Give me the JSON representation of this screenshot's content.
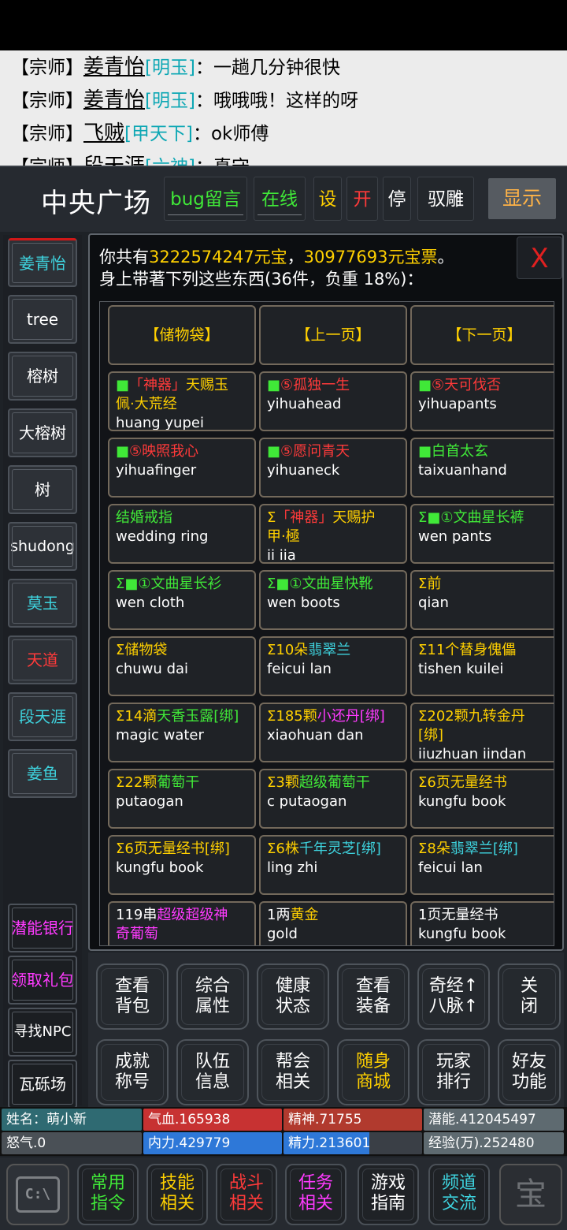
{
  "chat": [
    {
      "prefix": "【宗师】",
      "name": "姜青怡",
      "tag": "[明玉]",
      "msg": "：一趟几分钟很快"
    },
    {
      "prefix": "【宗师】",
      "name": "姜青怡",
      "tag": "[明玉]",
      "msg": "：哦哦哦！这样的呀"
    },
    {
      "prefix": "【宗师】",
      "name": "飞贼",
      "tag": "[甲天下]",
      "msg": "：ok师傅"
    },
    {
      "prefix": "【宗师】",
      "name": "段天涯",
      "tag": "[六神]",
      "msg": "：真守"
    }
  ],
  "header": {
    "location": "中央广场",
    "buttons": [
      "bug留言",
      "在线",
      "设",
      "开",
      "停",
      "驭雕"
    ],
    "show_label": "显示"
  },
  "left_players": [
    "姜青怡",
    "tree",
    "榕树",
    "大榕树",
    "树",
    "shudong",
    "莫玉",
    "天道",
    "段天涯",
    "姜鱼"
  ],
  "left_funcs": [
    "潜能银行",
    "领取礼包",
    "寻找NPC",
    "瓦砾场"
  ],
  "panel": {
    "line1_a": "你共有",
    "gold": "3222574247元宝",
    "line1_b": "，",
    "tickets": "30977693元宝票",
    "line1_c": "。",
    "line2": "身上带著下列这些东西(36件，负重 18%)：",
    "close": "X"
  },
  "nav": [
    "【储物袋】",
    "【上一页】",
    "【下一页】"
  ],
  "items": [
    {
      "p1": "■",
      "p1c": "g",
      "p2": "「神器」",
      "p2c": "r",
      "p3": "天赐玉",
      "p3c": "y",
      "line1b": "佩·大荒经",
      "line1bc": "y",
      "sub": "huang yupei"
    },
    {
      "p1": "■",
      "p1c": "g",
      "p2": "⑤孤独一生",
      "p2c": "r",
      "p3": "",
      "p3c": "w",
      "line1b": "",
      "line1bc": "w",
      "sub": "yihuahead"
    },
    {
      "p1": "■",
      "p1c": "g",
      "p2": "⑤天可伐否",
      "p2c": "r",
      "p3": "",
      "p3c": "w",
      "line1b": "",
      "line1bc": "w",
      "sub": "yihuapants"
    },
    {
      "p1": "■",
      "p1c": "g",
      "p2": "⑤映照我心",
      "p2c": "r",
      "p3": "",
      "p3c": "w",
      "line1b": "",
      "line1bc": "w",
      "sub": "yihuafinger"
    },
    {
      "p1": "■",
      "p1c": "g",
      "p2": "⑤愿问青天",
      "p2c": "r",
      "p3": "",
      "p3c": "w",
      "line1b": "",
      "line1bc": "w",
      "sub": "yihuaneck"
    },
    {
      "p1": "■",
      "p1c": "g",
      "p2": "白首太玄",
      "p2c": "g",
      "p3": "",
      "p3c": "w",
      "line1b": "",
      "line1bc": "w",
      "sub": "taixuanhand"
    },
    {
      "p1": "结婚戒指",
      "p1c": "g",
      "p2": "",
      "p2c": "w",
      "p3": "",
      "p3c": "w",
      "line1b": "",
      "line1bc": "w",
      "sub": "wedding ring"
    },
    {
      "p1": "Σ",
      "p1c": "y",
      "p2": "「神器」",
      "p2c": "r",
      "p3": "天赐护",
      "p3c": "y",
      "line1b": "甲·極",
      "line1bc": "y",
      "sub": "ii iia"
    },
    {
      "p1": "Σ■①文曲星长裤",
      "p1c": "g",
      "p2": "",
      "p2c": "w",
      "p3": "",
      "p3c": "w",
      "line1b": "",
      "line1bc": "w",
      "sub": "wen pants"
    },
    {
      "p1": "Σ■①文曲星长衫",
      "p1c": "g",
      "p2": "",
      "p2c": "w",
      "p3": "",
      "p3c": "w",
      "line1b": "",
      "line1bc": "w",
      "sub": "wen cloth"
    },
    {
      "p1": "Σ■①文曲星快靴",
      "p1c": "g",
      "p2": "",
      "p2c": "w",
      "p3": "",
      "p3c": "w",
      "line1b": "",
      "line1bc": "w",
      "sub": "wen boots"
    },
    {
      "p1": "Σ前",
      "p1c": "y",
      "p2": "",
      "p2c": "w",
      "p3": "",
      "p3c": "w",
      "line1b": "",
      "line1bc": "w",
      "sub": "qian"
    },
    {
      "p1": "Σ储物袋",
      "p1c": "y",
      "p2": "",
      "p2c": "w",
      "p3": "",
      "p3c": "w",
      "line1b": "",
      "line1bc": "w",
      "sub": "chuwu dai"
    },
    {
      "p1": "Σ10朵",
      "p1c": "y",
      "p2": "翡翠兰",
      "p2c": "c",
      "p3": "",
      "p3c": "w",
      "line1b": "",
      "line1bc": "w",
      "sub": "feicui lan"
    },
    {
      "p1": "Σ11个替身傀儡",
      "p1c": "y",
      "p2": "",
      "p2c": "w",
      "p3": "",
      "p3c": "w",
      "line1b": "",
      "line1bc": "w",
      "sub": "tishen kuilei"
    },
    {
      "p1": "Σ14滴",
      "p1c": "y",
      "p2": "天香玉露[绑]",
      "p2c": "g",
      "p3": "",
      "p3c": "w",
      "line1b": "",
      "line1bc": "w",
      "sub": "magic water"
    },
    {
      "p1": "Σ185颗",
      "p1c": "y",
      "p2": "小还丹[绑]",
      "p2c": "m",
      "p3": "",
      "p3c": "w",
      "line1b": "",
      "line1bc": "w",
      "sub": "xiaohuan dan"
    },
    {
      "p1": "Σ202颗",
      "p1c": "y",
      "p2": "九转金丹",
      "p2c": "y",
      "p3": "",
      "p3c": "w",
      "line1b": "[绑]",
      "line1bc": "y",
      "sub": "iiuzhuan iindan"
    },
    {
      "p1": "Σ22颗",
      "p1c": "y",
      "p2": "葡萄干",
      "p2c": "g",
      "p3": "",
      "p3c": "w",
      "line1b": "",
      "line1bc": "w",
      "sub": "putaogan"
    },
    {
      "p1": "Σ3颗",
      "p1c": "y",
      "p2": "超级葡萄干",
      "p2c": "g",
      "p3": "",
      "p3c": "w",
      "line1b": "",
      "line1bc": "w",
      "sub": "c putaogan"
    },
    {
      "p1": "Σ6页无量经书",
      "p1c": "y",
      "p2": "",
      "p2c": "w",
      "p3": "",
      "p3c": "w",
      "line1b": "",
      "line1bc": "w",
      "sub": "kungfu book"
    },
    {
      "p1": "Σ6页无量经书[绑]",
      "p1c": "y",
      "p2": "",
      "p2c": "w",
      "p3": "",
      "p3c": "w",
      "line1b": "",
      "line1bc": "w",
      "sub": "kungfu book"
    },
    {
      "p1": "Σ6株",
      "p1c": "y",
      "p2": "千年灵芝[绑]",
      "p2c": "c",
      "p3": "",
      "p3c": "w",
      "line1b": "",
      "line1bc": "w",
      "sub": "ling zhi"
    },
    {
      "p1": "Σ8朵",
      "p1c": "y",
      "p2": "翡翠兰[绑]",
      "p2c": "c",
      "p3": "",
      "p3c": "w",
      "line1b": "",
      "line1bc": "w",
      "sub": "feicui lan"
    },
    {
      "p1": "119串",
      "p1c": "w",
      "p2": "超级超级神",
      "p2c": "m",
      "p3": "",
      "p3c": "w",
      "line1b": "奇葡萄",
      "line1bc": "m",
      "sub": ""
    },
    {
      "p1": "1两",
      "p1c": "w",
      "p2": "黄金",
      "p2c": "y",
      "p3": "",
      "p3c": "w",
      "line1b": "",
      "line1bc": "w",
      "sub": "gold"
    },
    {
      "p1": "1页无量经书",
      "p1c": "w",
      "p2": "",
      "p2c": "w",
      "p3": "",
      "p3c": "w",
      "line1b": "",
      "line1bc": "w",
      "sub": "kungfu book"
    }
  ],
  "actions": [
    [
      "查看",
      "背包"
    ],
    [
      "综合",
      "属性"
    ],
    [
      "健康",
      "状态"
    ],
    [
      "查看",
      "装备"
    ],
    [
      "奇经↑",
      "八脉↑"
    ],
    [
      "关",
      "闭"
    ],
    [
      "成就",
      "称号"
    ],
    [
      "队伍",
      "信息"
    ],
    [
      "帮会",
      "相关"
    ],
    [
      "随身",
      "商城"
    ],
    [
      "玩家",
      "排行"
    ],
    [
      "好友",
      "功能"
    ]
  ],
  "stats": {
    "name": "姓名：萌小新",
    "hp": "气血.165938",
    "spirit": "精神.71755",
    "potential": "潜能.412045497",
    "rage": "怒气.0",
    "neili": "内力.429779",
    "energy": "精力.213601",
    "exp": "经验(万).252480"
  },
  "bottom": [
    [
      "常用",
      "指令"
    ],
    [
      "技能",
      "相关"
    ],
    [
      "战斗",
      "相关"
    ],
    [
      "任务",
      "相关"
    ],
    [
      "游戏",
      "指南"
    ],
    [
      "频道",
      "交流"
    ]
  ],
  "cmd_icon": "C:\\",
  "seal_icon": "宝",
  "colors": {
    "yellow": "#ffd000",
    "green": "#40e838",
    "red": "#ff3a3a",
    "cyan": "#3ed3de",
    "magenta": "#ff3aff"
  }
}
